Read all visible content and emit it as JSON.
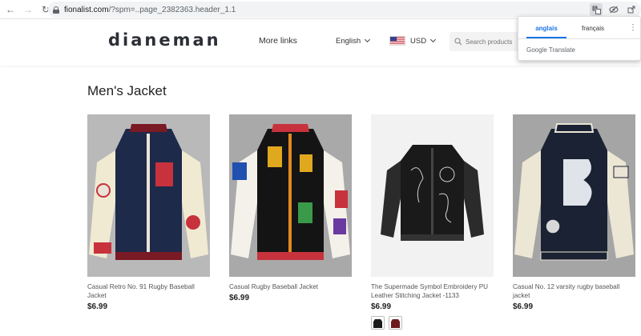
{
  "browser": {
    "url_host": "fionalist.com",
    "url_path": "/?spm=..page_2382363.header_1.1"
  },
  "site": {
    "logo": "dianeman",
    "nav": {
      "more_links": "More links",
      "language": "English",
      "currency": "USD"
    },
    "search": {
      "placeholder": "Search products"
    }
  },
  "translate_popup": {
    "tab_selected": "anglais",
    "tab_other": "français",
    "footer_brand": "Google",
    "footer_product": "Translate"
  },
  "page": {
    "title": "Men's Jacket",
    "products": [
      {
        "name": "Casual Retro No. 91 Rugby Baseball Jacket",
        "price": "$6.99",
        "body_color": "#1e2a4a",
        "sleeve_color": "#f1ead2",
        "bg_color": "#b9b9b9"
      },
      {
        "name": "Casual Rugby Baseball Jacket",
        "price": "$6.99",
        "body_color": "#141414",
        "sleeve_color": "#f4f1ea",
        "bg_color": "#a9a9a9"
      },
      {
        "name": "The Supermade Symbol Embroidery PU Leather Stitching Jacket -1133",
        "price": "$6.99",
        "body_color": "#1a1a1a",
        "sleeve_color": "#2b2b2b",
        "bg_color": "#f2f2f2",
        "swatches": [
          "#1a1a1a",
          "#6d1a1f"
        ]
      },
      {
        "name": "Casual No. 12 varsity rugby baseball jacket",
        "price": "$6.99",
        "body_color": "#1a2233",
        "sleeve_color": "#ece6d4",
        "bg_color": "#a5a5a5"
      }
    ]
  }
}
